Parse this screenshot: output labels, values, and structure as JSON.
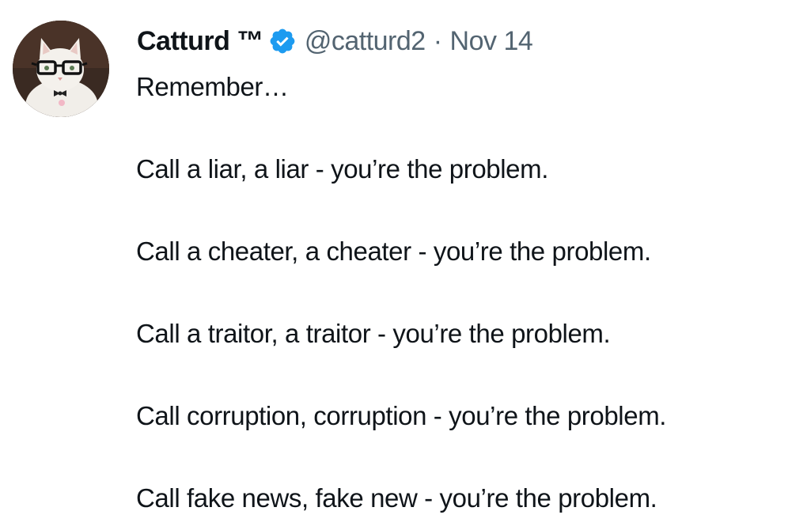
{
  "tweet": {
    "author": {
      "display_name": "Catturd ™",
      "handle": "@catturd2",
      "separator": "·",
      "date": "Nov 14",
      "verified_icon": "verified-badge-icon",
      "avatar": "cat-with-glasses-avatar"
    },
    "lines": [
      "Remember…",
      "Call a liar, a liar - you’re the problem.",
      "Call a cheater, a cheater - you’re the problem.",
      "Call a traitor, a traitor - you’re the problem.",
      "Call corruption, corruption - you’re the problem.",
      "Call fake news, fake new - you’re the problem."
    ],
    "colors": {
      "text": "#0f1419",
      "secondary": "#536471",
      "verified": "#1d9bf0"
    }
  }
}
